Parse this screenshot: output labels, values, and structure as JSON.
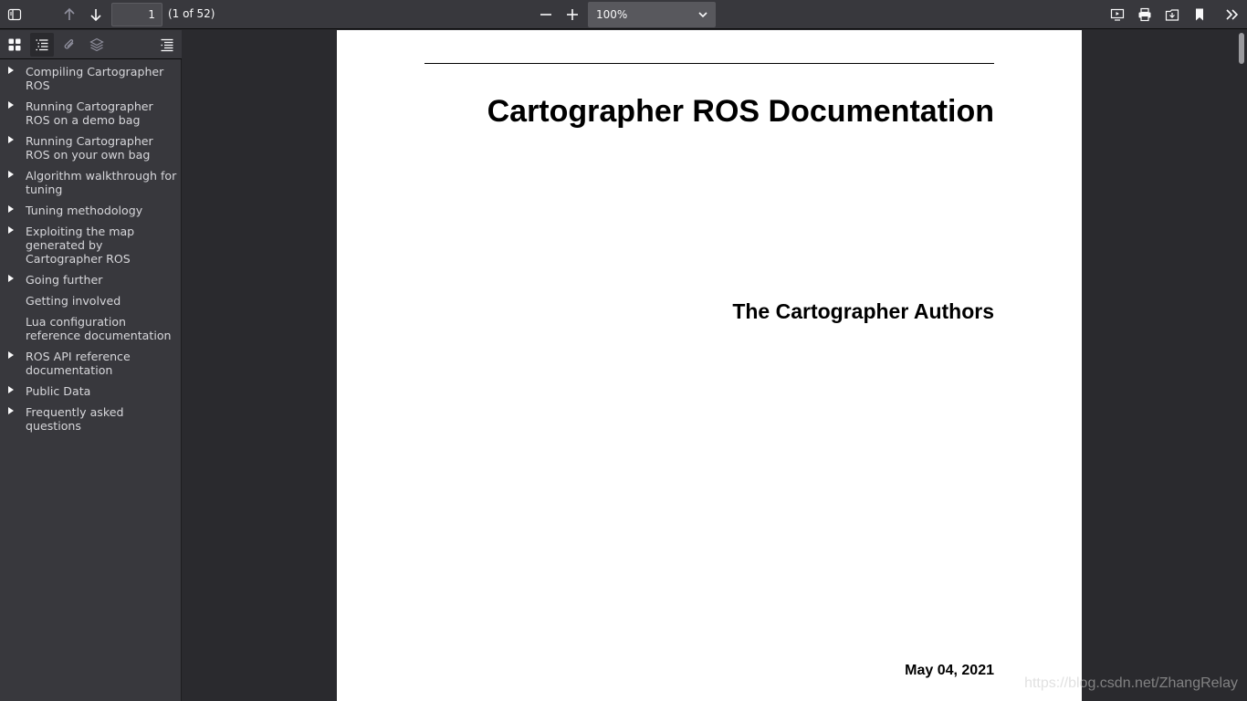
{
  "toolbar": {
    "page_number": "1",
    "page_count": "(1 of 52)",
    "zoom": "100%",
    "icons": [
      "sidebar-toggle-icon",
      "arrow-up-icon",
      "arrow-down-icon",
      "zoom-out-icon",
      "zoom-in-icon",
      "presentation-icon",
      "print-icon",
      "download-icon",
      "bookmark-icon",
      "double-chevron-right-icon"
    ]
  },
  "sidebar": {
    "view_buttons": [
      "thumbnails-icon",
      "outline-icon",
      "attachments-icon",
      "layers-icon",
      "current-outline-item-icon"
    ],
    "outline": [
      {
        "label": "Compiling Cartographer ROS",
        "expandable": true
      },
      {
        "label": "Running Cartographer ROS on a demo bag",
        "expandable": true
      },
      {
        "label": "Running Cartographer ROS on your own bag",
        "expandable": true
      },
      {
        "label": "Algorithm walkthrough for tuning",
        "expandable": true
      },
      {
        "label": "Tuning methodology",
        "expandable": true
      },
      {
        "label": "Exploiting the map generated by Cartographer ROS",
        "expandable": true
      },
      {
        "label": "Going further",
        "expandable": true
      },
      {
        "label": "Getting involved",
        "expandable": false
      },
      {
        "label": "Lua configuration reference documentation",
        "expandable": false
      },
      {
        "label": "ROS API reference documentation",
        "expandable": true
      },
      {
        "label": "Public Data",
        "expandable": true
      },
      {
        "label": "Frequently asked questions",
        "expandable": true
      }
    ]
  },
  "document": {
    "title": "Cartographer ROS Documentation",
    "author": "The Cartographer Authors",
    "date": "May 04, 2021"
  },
  "watermark": "https://blog.csdn.net/ZhangRelay",
  "colors": {
    "toolbar_bg": "#38383d",
    "viewer_bg": "#2a2a2e",
    "page_bg": "#ffffff",
    "text_light": "#d7d7db"
  }
}
